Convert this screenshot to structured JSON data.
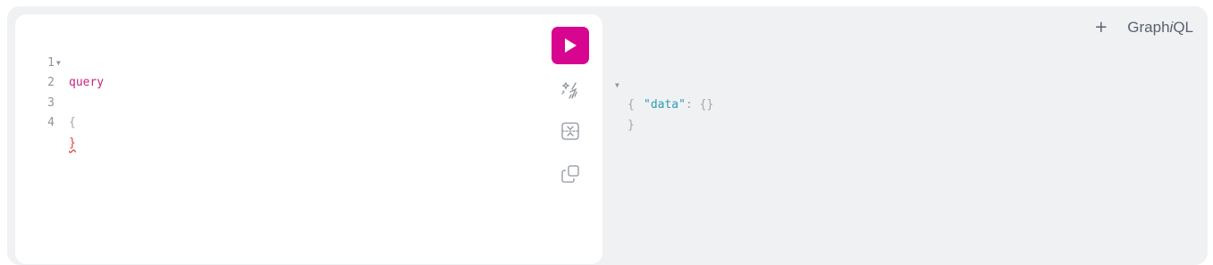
{
  "header": {
    "add_tab_label": "+",
    "brand_pre": "Graph",
    "brand_italic": "i",
    "brand_post": "QL"
  },
  "editor": {
    "lines": [
      {
        "number": "1",
        "text": "query"
      },
      {
        "number": "2",
        "text": "{"
      },
      {
        "number": "3",
        "text": ""
      },
      {
        "number": "4",
        "text": "}"
      }
    ]
  },
  "toolbar": {
    "run_icon": "play-icon",
    "prettify_icon": "magic-wand-icon",
    "merge_icon": "merge-icon",
    "copy_icon": "copy-icon"
  },
  "result": {
    "open": "{",
    "key": "\"data\"",
    "sep": ": ",
    "value": "{}",
    "close": "}"
  },
  "colors": {
    "accent": "#d7058f",
    "keyword": "#c5257d",
    "string": "#2a9db5",
    "error": "#e0403a"
  }
}
